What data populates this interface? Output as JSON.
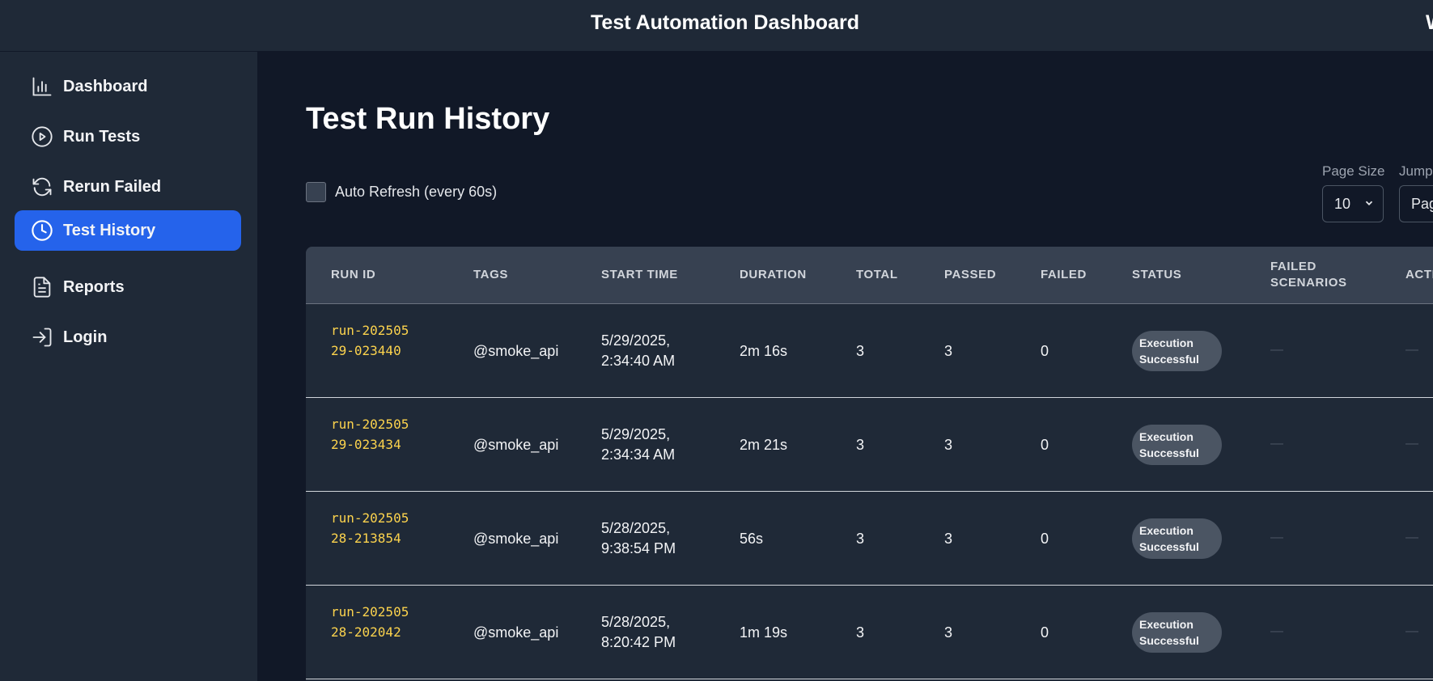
{
  "header": {
    "title": "Test Automation Dashboard",
    "user_initial": "W"
  },
  "sidebar": {
    "items": [
      {
        "label": "Dashboard",
        "icon": "bar-chart-icon"
      },
      {
        "label": "Run Tests",
        "icon": "play-circle-icon"
      },
      {
        "label": "Rerun Failed",
        "icon": "refresh-icon"
      },
      {
        "label": "Test History",
        "icon": "clock-icon",
        "active": true
      },
      {
        "label": "Reports",
        "icon": "document-icon"
      },
      {
        "label": "Login",
        "icon": "login-icon"
      }
    ]
  },
  "page": {
    "title": "Test Run History",
    "auto_refresh_label": "Auto Refresh (every 60s)",
    "page_size_label": "Page Size",
    "page_size_value": "10",
    "jump_label": "Jump",
    "jump_value": "Pag"
  },
  "table": {
    "headers": [
      "RUN ID",
      "TAGS",
      "START TIME",
      "DURATION",
      "TOTAL",
      "PASSED",
      "FAILED",
      "STATUS",
      "FAILED SCENARIOS",
      "ACTI"
    ],
    "rows": [
      {
        "run_id": "run-20250529-023440",
        "tags": "@smoke_api",
        "start_time": "5/29/2025, 2:34:40 AM",
        "duration": "2m 16s",
        "total": "3",
        "passed": "3",
        "failed": "0",
        "status": "Execution Successful",
        "failed_scenarios": "—",
        "actions": "—"
      },
      {
        "run_id": "run-20250529-023434",
        "tags": "@smoke_api",
        "start_time": "5/29/2025, 2:34:34 AM",
        "duration": "2m 21s",
        "total": "3",
        "passed": "3",
        "failed": "0",
        "status": "Execution Successful",
        "failed_scenarios": "—",
        "actions": "—"
      },
      {
        "run_id": "run-20250528-213854",
        "tags": "@smoke_api",
        "start_time": "5/28/2025, 9:38:54 PM",
        "duration": "56s",
        "total": "3",
        "passed": "3",
        "failed": "0",
        "status": "Execution Successful",
        "failed_scenarios": "—",
        "actions": "—"
      },
      {
        "run_id": "run-20250528-202042",
        "tags": "@smoke_api",
        "start_time": "5/28/2025, 8:20:42 PM",
        "duration": "1m 19s",
        "total": "3",
        "passed": "3",
        "failed": "0",
        "status": "Execution Successful",
        "failed_scenarios": "—",
        "actions": "—"
      }
    ]
  },
  "colors": {
    "accent": "#2563eb",
    "run_id": "#fcd34d",
    "badge": "#4b5563"
  }
}
